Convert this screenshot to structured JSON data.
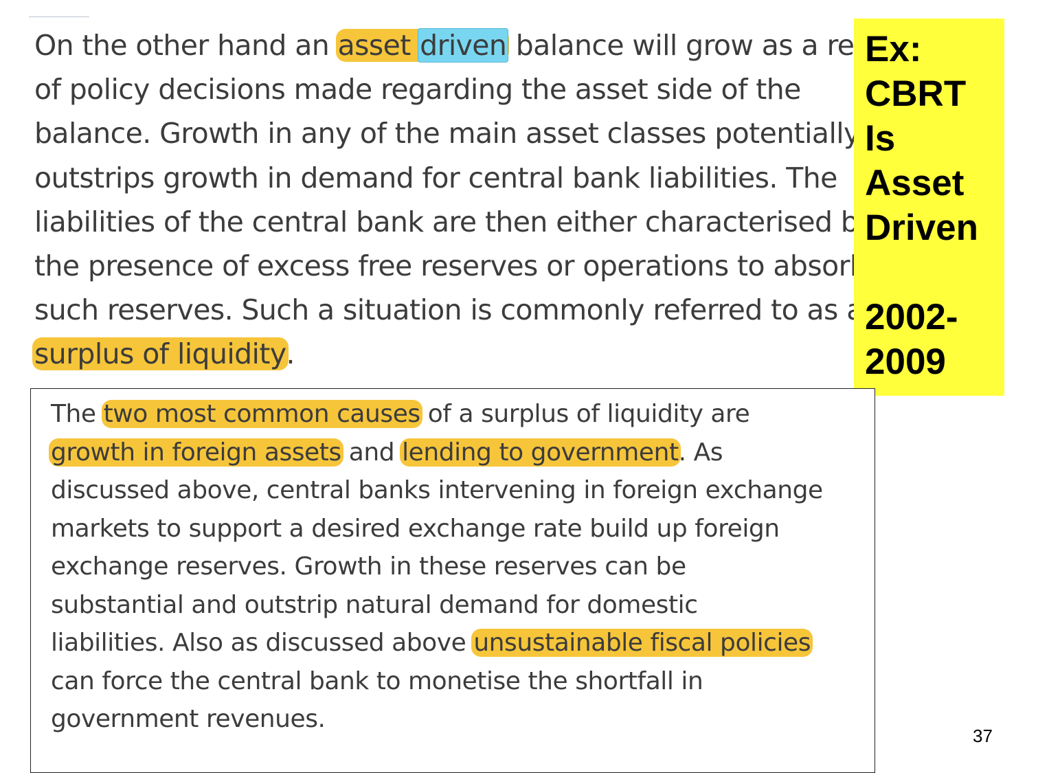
{
  "top_excerpt": {
    "line1": {
      "before": "On the other hand an ",
      "hl_a": "asset ",
      "hl_b": "driven",
      "after": " balance will grow as a result"
    },
    "line2": "of policy decisions made regarding the asset side of the",
    "line3": "balance.  Growth in any of the main asset classes potentially",
    "line4": "outstrips growth in demand for central bank liabilities.  The",
    "line5": "liabilities of the central bank are then either characterised by",
    "line6": "the presence of excess free reserves or operations to absorb",
    "line7": "such reserves.  Such a situation is commonly referred to as a",
    "line8": {
      "hl": "surplus of liquidity",
      "after": "."
    }
  },
  "callout": {
    "line1": "Ex:",
    "line2": "CBRT",
    "line3": "Is",
    "line4": "Asset",
    "line5": "Driven",
    "line6": "2002-",
    "line7": "2009",
    "background_color": "#ffff3c"
  },
  "bottom_excerpt": {
    "line1": {
      "before": "The ",
      "hl": "two most common causes",
      "after": " of a surplus of liquidity are"
    },
    "line2": {
      "hl1": "growth in foreign assets",
      "mid": " and ",
      "hl2": "lending to government",
      "after": ".  As"
    },
    "line3": "discussed above, central banks intervening in foreign exchange",
    "line4": "markets to support a desired exchange rate build up foreign",
    "line5": "exchange reserves.  Growth in these reserves can be",
    "line6": "substantial and outstrip natural demand for domestic",
    "line7": {
      "before": "liabilities.  Also as discussed above ",
      "hl": "unsustainable fiscal policies"
    },
    "line8": "can force the central bank to monetise the shortfall in",
    "line9": "government revenues."
  },
  "highlight_color": "#f6c53a",
  "selection_color": "#79d6f0",
  "page_number": "37"
}
